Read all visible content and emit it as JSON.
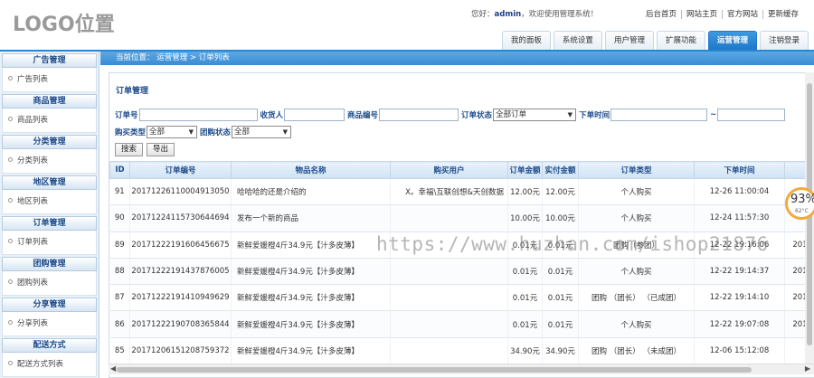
{
  "header": {
    "logo": "LOGO位置",
    "welcome_prefix": "您好：",
    "username": "admin",
    "welcome_suffix": "，欢迎使用管理系统！",
    "links": [
      "后台首页",
      "网站主页",
      "官方网站",
      "更新缓存"
    ],
    "tabs": [
      {
        "label": "我的面板",
        "active": false
      },
      {
        "label": "系统设置",
        "active": false
      },
      {
        "label": "用户管理",
        "active": false
      },
      {
        "label": "扩展功能",
        "active": false
      },
      {
        "label": "运营管理",
        "active": true
      },
      {
        "label": "注销登录",
        "active": false
      }
    ]
  },
  "sidebar": [
    {
      "title": "广告管理",
      "item": "广告列表"
    },
    {
      "title": "商品管理",
      "item": "商品列表"
    },
    {
      "title": "分类管理",
      "item": "分类列表"
    },
    {
      "title": "地区管理",
      "item": "地区列表"
    },
    {
      "title": "订单管理",
      "item": "订单列表"
    },
    {
      "title": "团购管理",
      "item": "团购列表"
    },
    {
      "title": "分享管理",
      "item": "分享列表"
    },
    {
      "title": "配送方式",
      "item": "配送方式列表"
    }
  ],
  "breadcrumb": "当前位置： 运营管理 > 订单列表",
  "panel_title": "订单管理",
  "filters": {
    "order_no_label": "订单号",
    "recipient_label": "收货人",
    "goods_no_label": "商品编号",
    "order_status_label": "订单状态",
    "order_status_value": "全部订单",
    "order_time_label": "下单时间",
    "range_sep": "~",
    "buy_type_label": "购买类型",
    "buy_type_value": "全部",
    "group_status_label": "团购状态",
    "group_status_value": "全部",
    "search_button": "搜索",
    "export_button": "导出"
  },
  "table": {
    "columns": [
      "ID",
      "订单编号",
      "物品名称",
      "购买用户",
      "订单金额",
      "实付金额",
      "订单类型",
      "下单时间",
      ""
    ],
    "rows": [
      {
        "id": "91",
        "order_no": "20171226110004913050",
        "goods": "哈哈哈的还是介绍的",
        "user": "X。幸福\\互联创想&天创数据",
        "amount": "12.00元",
        "paid": "12.00元",
        "type": "个人购买",
        "time": "12-26 11:00:04",
        "extra": ""
      },
      {
        "id": "90",
        "order_no": "20171224115730644694",
        "goods": "发布一个新的商品",
        "user": "",
        "amount": "10.00元",
        "paid": "10.00元",
        "type": "个人购买",
        "time": "12-24 11:57:30",
        "extra": ""
      },
      {
        "id": "89",
        "order_no": "20171222191606456675",
        "goods": "新鲜爱媛橙4斤34.9元【汁多皮薄】",
        "user": "",
        "amount": "0.01元",
        "paid": "0.01元",
        "type": "团购（参团）",
        "time": "12-22 19:16:06",
        "extra": "201"
      },
      {
        "id": "88",
        "order_no": "20171222191437876005",
        "goods": "新鲜爱媛橙4斤34.9元【汁多皮薄】",
        "user": "",
        "amount": "0.01元",
        "paid": "0.01元",
        "type": "个人购买",
        "time": "12-22 19:14:37",
        "extra": "201"
      },
      {
        "id": "87",
        "order_no": "20171222191410949629",
        "goods": "新鲜爱媛橙4斤34.9元【汁多皮薄】",
        "user": "",
        "amount": "0.01元",
        "paid": "0.01元",
        "type": "团购 （团长） （已成团）",
        "time": "12-22 19:14:10",
        "extra": "201"
      },
      {
        "id": "86",
        "order_no": "20171222190708365844",
        "goods": "新鲜爱媛橙4斤34.9元【汁多皮薄】",
        "user": "",
        "amount": "0.01元",
        "paid": "0.01元",
        "type": "个人购买",
        "time": "12-22 19:07:08",
        "extra": "201"
      },
      {
        "id": "85",
        "order_no": "20171206151208759372",
        "goods": "新鲜爱媛橙4斤34.9元【汁多皮薄】",
        "user": "",
        "amount": "34.90元",
        "paid": "34.90元",
        "type": "团购 （团长） （未成团）",
        "time": "12-06 15:12:08",
        "extra": ""
      }
    ]
  },
  "widget": {
    "percent": "93%",
    "temp": "62°C"
  },
  "watermark": "https://www.huzhan.com/ishop21876",
  "colors": {
    "accent": "#2a86d1",
    "tab_active": "#1f78c8",
    "label": "#1c4a8a",
    "gauge": "#f4a93b"
  }
}
